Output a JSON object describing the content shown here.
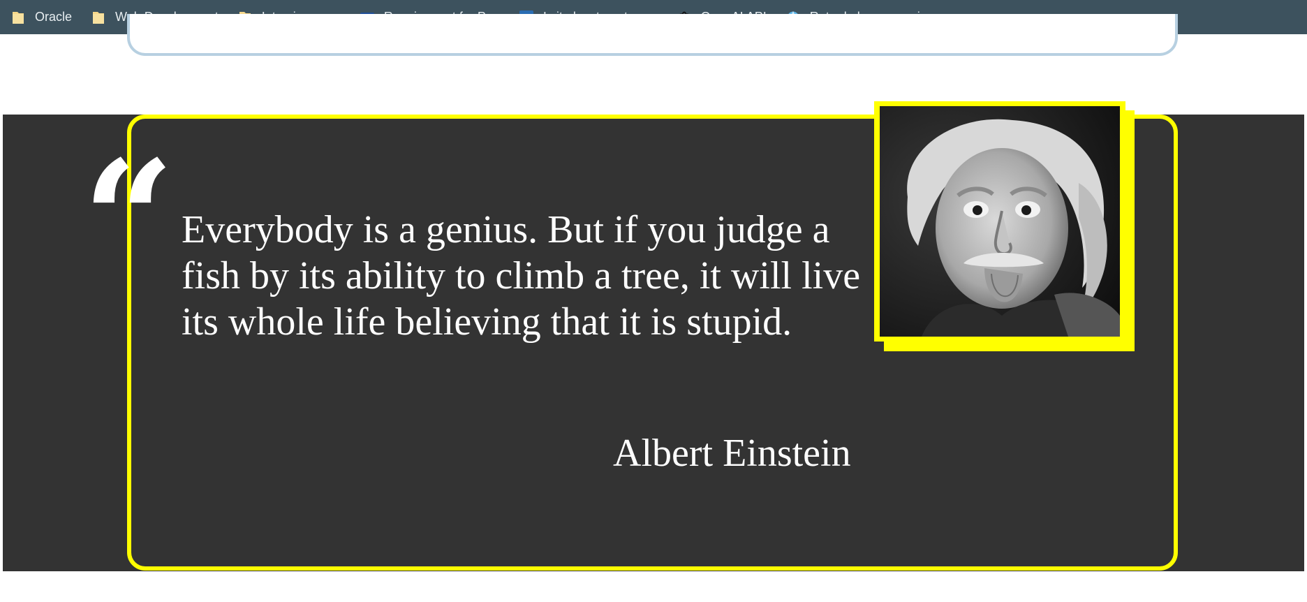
{
  "bookmarks": [
    {
      "label": "Oracle",
      "icon": "folder-icon"
    },
    {
      "label": "Web Development",
      "icon": "folder-icon"
    },
    {
      "label": "Interview prep",
      "icon": "folder-icon"
    },
    {
      "label": "Requirement for Pr...",
      "icon": "cdc-logo-icon"
    },
    {
      "label": "Is it okay to get my...",
      "icon": "gov-site-icon"
    },
    {
      "label": "OpenAI API",
      "icon": "openai-logo-icon"
    },
    {
      "label": "Ruta de la vacunaci...",
      "icon": "globe-icon"
    }
  ],
  "quote": {
    "mark": "“",
    "text": "Everybody is a genius. But if you judge a fish by its ability to climb a tree, it will live its whole life believing that it is stupid.",
    "author": "Albert Einstein"
  },
  "colors": {
    "bookmarks_bar": "#3d525e",
    "section_bg": "#333333",
    "accent_yellow": "#ffff00",
    "prev_card_border": "#b7d0e1"
  }
}
